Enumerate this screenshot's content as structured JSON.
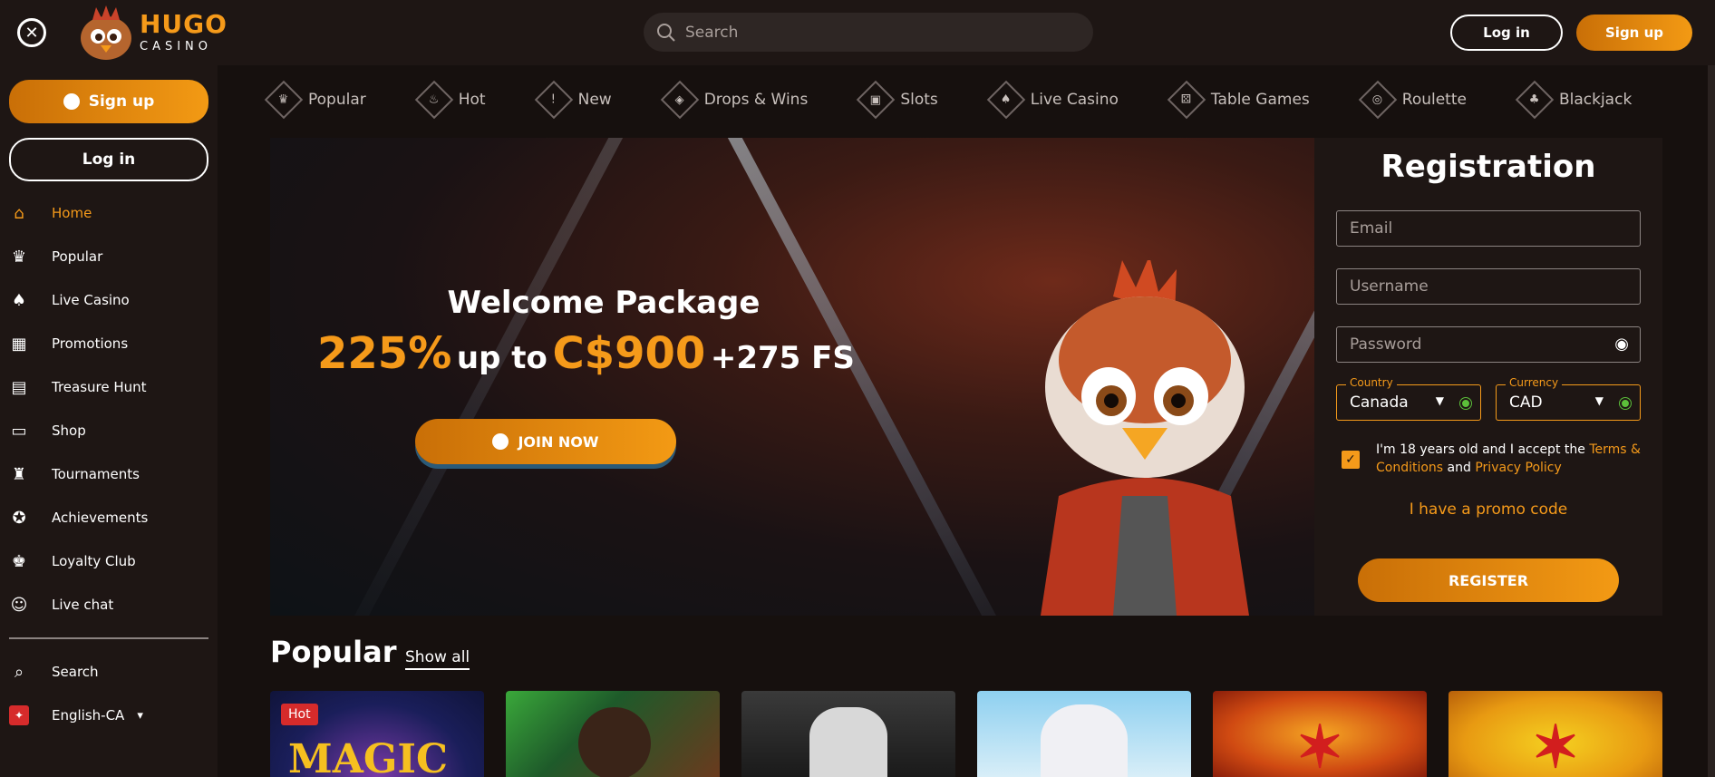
{
  "brand": {
    "name": "HUGO",
    "sub": "CASINO"
  },
  "header": {
    "search_placeholder": "Search",
    "login_label": "Log in",
    "signup_label": "Sign up"
  },
  "sidebar": {
    "signup_label": "Sign up",
    "login_label": "Log in",
    "items": [
      {
        "label": "Home",
        "icon": "home-icon",
        "active": true
      },
      {
        "label": "Popular",
        "icon": "crown-icon"
      },
      {
        "label": "Live Casino",
        "icon": "cards-icon"
      },
      {
        "label": "Promotions",
        "icon": "gift-icon"
      },
      {
        "label": "Treasure Hunt",
        "icon": "chest-icon"
      },
      {
        "label": "Shop",
        "icon": "shop-icon"
      },
      {
        "label": "Tournaments",
        "icon": "trophy-icon"
      },
      {
        "label": "Achievements",
        "icon": "medal-icon"
      },
      {
        "label": "Loyalty Club",
        "icon": "crown-icon"
      },
      {
        "label": "Live chat",
        "icon": "chat-icon"
      }
    ],
    "search_label": "Search",
    "language_label": "English-CA"
  },
  "categories": [
    {
      "label": "Popular"
    },
    {
      "label": "Hot"
    },
    {
      "label": "New"
    },
    {
      "label": "Drops & Wins"
    },
    {
      "label": "Slots"
    },
    {
      "label": "Live Casino"
    },
    {
      "label": "Table Games"
    },
    {
      "label": "Roulette"
    },
    {
      "label": "Blackjack"
    }
  ],
  "banner": {
    "title": "Welcome Package",
    "percent": "225%",
    "up_to": "up to",
    "amount": "C$900",
    "fs": "+275 FS",
    "join_label": "JOIN NOW"
  },
  "registration": {
    "title": "Registration",
    "email_placeholder": "Email",
    "username_placeholder": "Username",
    "password_placeholder": "Password",
    "country_label": "Country",
    "country_value": "Canada",
    "currency_label": "Currency",
    "currency_value": "CAD",
    "terms_prefix": "I'm 18 years old and I accept the ",
    "terms_link": "Terms & Conditions",
    "terms_and": " and ",
    "privacy_link": "Privacy Policy",
    "promo_label": "I have a promo code",
    "register_label": "REGISTER"
  },
  "popular": {
    "title": "Popular",
    "show_all": "Show all",
    "badge": "Hot",
    "tile_title": "MAGIC"
  },
  "colors": {
    "accent": "#f59a1a",
    "bg": "#16100e",
    "panel": "#1e1614"
  }
}
